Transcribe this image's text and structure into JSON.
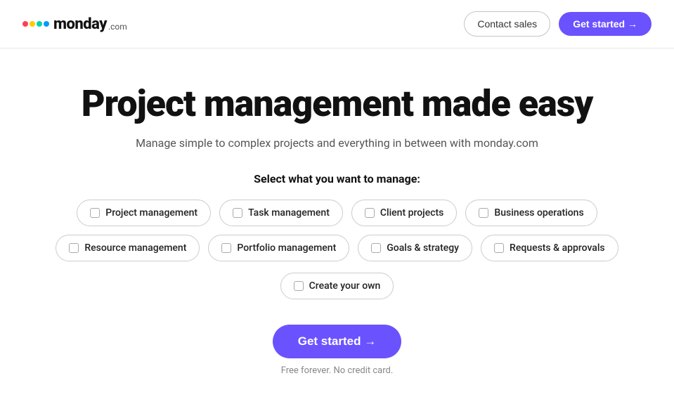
{
  "header": {
    "logo": {
      "text_monday": "monday",
      "text_com": ".com",
      "dots": [
        {
          "color": "#ff3d57"
        },
        {
          "color": "#ffcb00"
        },
        {
          "color": "#00d4ac"
        },
        {
          "color": "#0099ff"
        }
      ]
    },
    "contact_sales_label": "Contact sales",
    "get_started_label": "Get started →"
  },
  "main": {
    "title": "Project management made easy",
    "subtitle": "Manage simple to complex projects and everything in between with monday.com",
    "select_label": "Select what you want to manage:",
    "options_row1": [
      {
        "id": "project-management",
        "label": "Project management"
      },
      {
        "id": "task-management",
        "label": "Task management"
      },
      {
        "id": "client-projects",
        "label": "Client projects"
      },
      {
        "id": "business-operations",
        "label": "Business operations"
      }
    ],
    "options_row2": [
      {
        "id": "resource-management",
        "label": "Resource management"
      },
      {
        "id": "portfolio-management",
        "label": "Portfolio management"
      },
      {
        "id": "goals-strategy",
        "label": "Goals & strategy"
      },
      {
        "id": "requests-approvals",
        "label": "Requests & approvals"
      }
    ],
    "create_own_label": "Create your own",
    "get_started_main_label": "Get started →",
    "free_text": "Free forever. No credit card."
  }
}
